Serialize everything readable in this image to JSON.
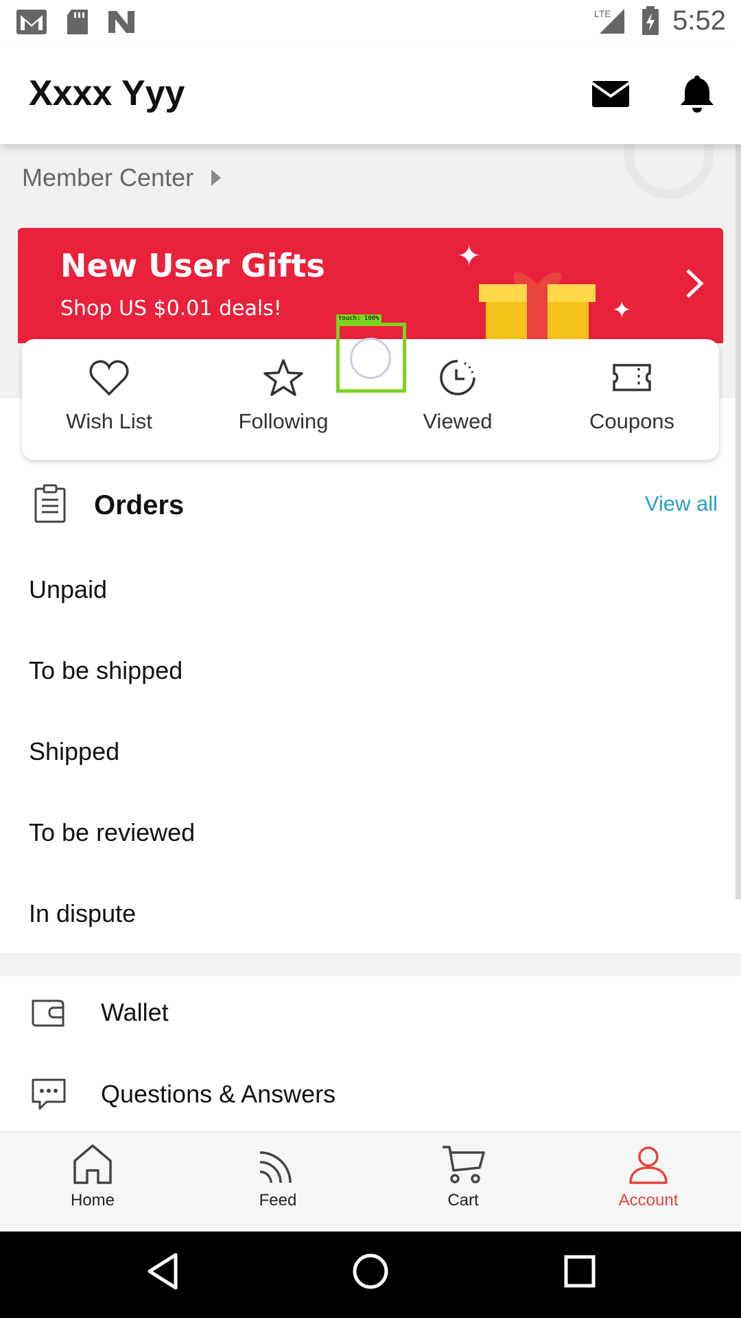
{
  "status_bar": {
    "time": "5:52",
    "network": "LTE",
    "left_icons": [
      "gmail-icon",
      "sd-card-icon",
      "n-icon"
    ],
    "right_icons": [
      "lte-signal-icon",
      "battery-charging-icon"
    ]
  },
  "header": {
    "title": "Xxxx Yyy",
    "icons": [
      "mail-icon",
      "bell-icon"
    ]
  },
  "member": {
    "label": "Member Center"
  },
  "banner": {
    "title": "New User Gifts",
    "subtitle": "Shop US $0.01 deals!",
    "color": "#e9213a"
  },
  "quick_actions": [
    {
      "label": "Wish List",
      "icon": "heart-icon"
    },
    {
      "label": "Following",
      "icon": "star-icon"
    },
    {
      "label": "Viewed",
      "icon": "clock-icon"
    },
    {
      "label": "Coupons",
      "icon": "ticket-icon"
    }
  ],
  "orders": {
    "title": "Orders",
    "view_all": "View all",
    "statuses": [
      "Unpaid",
      "To be shipped",
      "Shipped",
      "To be reviewed",
      "In dispute"
    ]
  },
  "menu": [
    {
      "label": "Wallet",
      "icon": "wallet-icon"
    },
    {
      "label": "Questions & Answers",
      "icon": "chat-bubble-icon"
    }
  ],
  "touch_overlay": {
    "tag": "touch: 100%"
  },
  "bottom_nav": [
    {
      "label": "Home",
      "icon": "home-icon",
      "active": false
    },
    {
      "label": "Feed",
      "icon": "feed-icon",
      "active": false
    },
    {
      "label": "Cart",
      "icon": "cart-icon",
      "active": false
    },
    {
      "label": "Account",
      "icon": "account-icon",
      "active": true
    }
  ],
  "colors": {
    "accent_red": "#e8433c",
    "link_blue": "#2a9fc2",
    "touch_green": "#7ed321"
  },
  "system_nav": [
    "back-icon",
    "home-circle-icon",
    "recents-icon"
  ]
}
